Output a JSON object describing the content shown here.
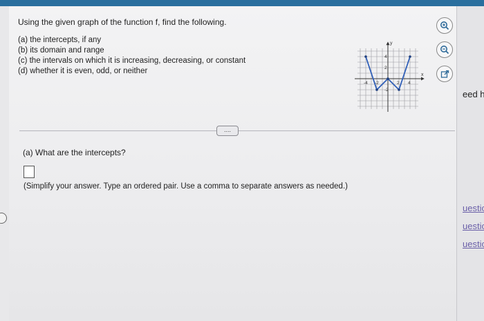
{
  "question": {
    "prompt": "Using the given graph of the function f, find the following.",
    "parts": [
      "(a) the intercepts, if any",
      "(b) its domain and range",
      "(c) the intervals on which it is increasing, decreasing, or constant",
      "(d) whether it is even, odd, or neither"
    ]
  },
  "graph": {
    "x_axis_label": "x",
    "y_axis_label": "y",
    "x_tick_labels": [
      "-4",
      "-2",
      "2",
      "4"
    ],
    "y_tick_labels": [
      "4",
      "2",
      "-2"
    ],
    "points": [
      [
        -4,
        4
      ],
      [
        -2,
        -2
      ],
      [
        0,
        0
      ],
      [
        2,
        -2
      ],
      [
        4,
        4
      ]
    ],
    "line_color": "#2f5fb8"
  },
  "tools": {
    "zoom_in": "zoom-in-icon",
    "zoom_out": "zoom-out-icon",
    "open_new": "external-link-icon"
  },
  "more_button": "....",
  "subquestion": {
    "prompt": "(a) What are the intercepts?",
    "hint": "(Simplify your answer. Type an ordered pair. Use a comma to separate answers as needed.)"
  },
  "right_strip": {
    "fragment": "eed h",
    "links": [
      "uestio",
      "uestion",
      "uestion"
    ]
  }
}
